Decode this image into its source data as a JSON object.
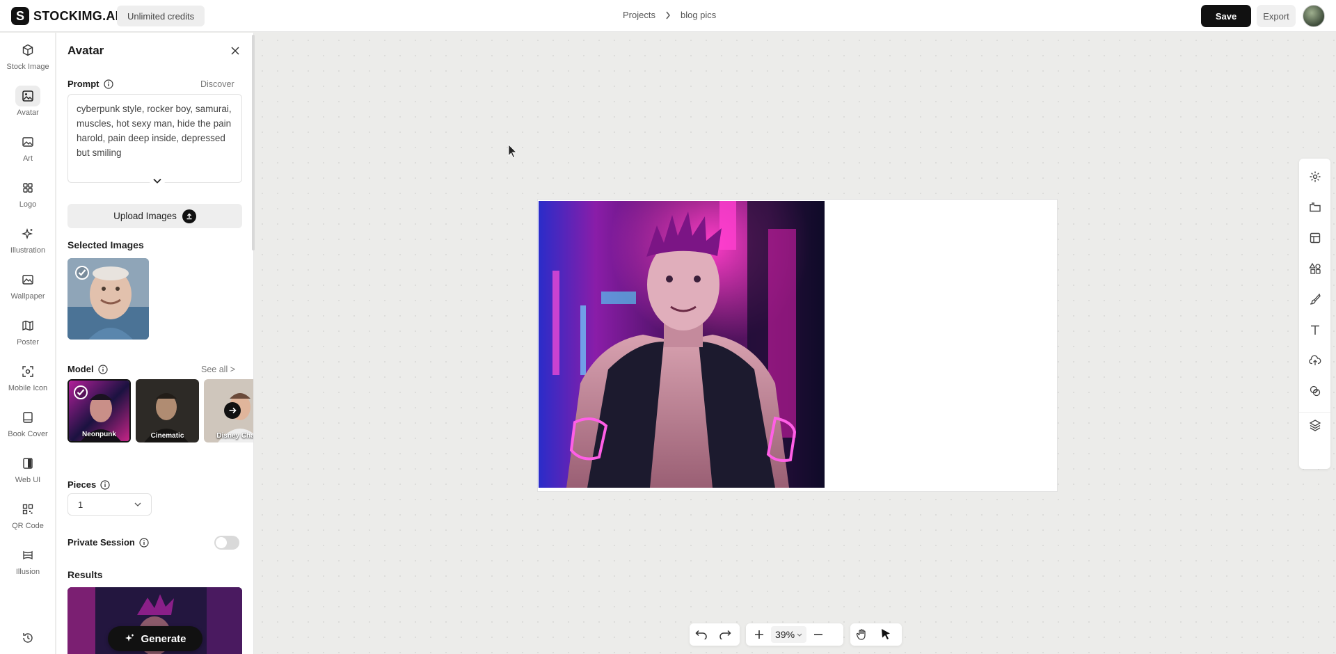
{
  "app": {
    "brand": "STOCKIMG.AI",
    "brand_mark": "S",
    "credits": "Unlimited credits"
  },
  "breadcrumb": {
    "root": "Projects",
    "current": "blog pics"
  },
  "header": {
    "save_label": "Save",
    "export_label": "Export"
  },
  "rail": {
    "items": [
      {
        "label": "Stock Image",
        "icon": "cube-icon"
      },
      {
        "label": "Avatar",
        "icon": "image-icon"
      },
      {
        "label": "Art",
        "icon": "picture-icon"
      },
      {
        "label": "Logo",
        "icon": "grid-icon"
      },
      {
        "label": "Illustration",
        "icon": "sparkles-icon"
      },
      {
        "label": "Wallpaper",
        "icon": "wallpaper-icon"
      },
      {
        "label": "Poster",
        "icon": "map-icon"
      },
      {
        "label": "Mobile Icon",
        "icon": "focus-icon"
      },
      {
        "label": "Book Cover",
        "icon": "book-icon"
      },
      {
        "label": "Web UI",
        "icon": "layout-icon"
      },
      {
        "label": "QR Code",
        "icon": "qr-icon"
      },
      {
        "label": "Illusion",
        "icon": "illusion-icon"
      }
    ],
    "active": "Avatar"
  },
  "panel": {
    "title": "Avatar",
    "prompt_label": "Prompt",
    "discover_label": "Discover",
    "prompt_text": "cyberpunk style, rocker boy, samurai, muscles, hot sexy man, hide the pain harold, pain deep inside, depressed but smiling",
    "upload_label": "Upload Images",
    "selected_images_title": "Selected Images",
    "model_label": "Model",
    "see_all_label": "See all >",
    "models": [
      {
        "label": "Neonpunk",
        "selected": true
      },
      {
        "label": "Cinematic",
        "selected": false
      },
      {
        "label": "Disney Cha",
        "selected": false
      }
    ],
    "pieces_label": "Pieces",
    "pieces_value": "1",
    "private_label": "Private Session",
    "private_enabled": false,
    "results_title": "Results",
    "generate_label": "Generate"
  },
  "canvas": {
    "zoom": "39%"
  },
  "colors": {
    "accent": "#111111",
    "neon_pink": "#ff2bd6",
    "neon_blue": "#3a6bff"
  }
}
